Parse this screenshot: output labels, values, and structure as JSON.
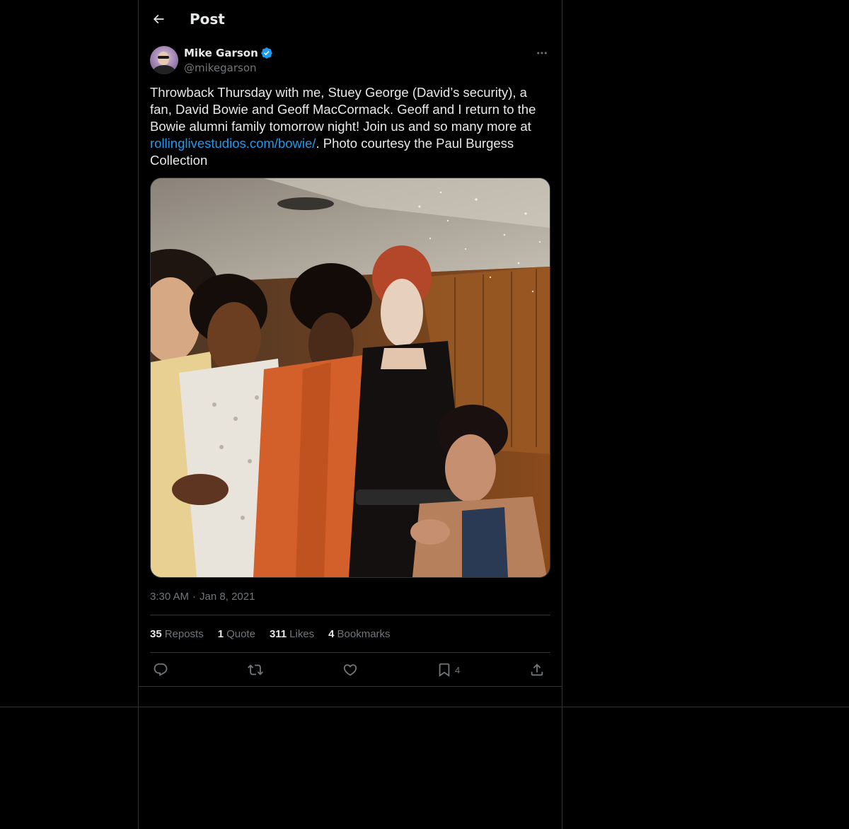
{
  "header": {
    "title": "Post"
  },
  "author": {
    "name": "Mike Garson",
    "handle": "@mikegarson",
    "verified": true
  },
  "tweet": {
    "text_before_link": "Throwback Thursday with me, Stuey George (David’s security), a fan, David Bowie and Geoff MacCormack. Geoff and I return to the Bowie alumni family tomorrow night! Join us and so many more at ",
    "link_text": "rollinglivestudios.com/bowie/",
    "text_after_link": ". Photo courtesy the Paul Burgess Collection",
    "time": "3:30 AM",
    "separator": "·",
    "date": "Jan 8, 2021"
  },
  "stats": {
    "reposts_count": "35",
    "reposts_label": "Reposts",
    "quotes_count": "1",
    "quotes_label": "Quote",
    "likes_count": "311",
    "likes_label": "Likes",
    "bookmarks_count": "4",
    "bookmarks_label": "Bookmarks"
  },
  "actions": {
    "bookmark_count": "4"
  },
  "icons": {
    "back": "arrow-left-icon",
    "verified": "verified-badge-icon",
    "more": "more-horizontal-icon",
    "reply": "reply-icon",
    "repost": "repost-icon",
    "like": "heart-icon",
    "bookmark": "bookmark-icon",
    "share": "share-icon"
  },
  "colors": {
    "background": "#000000",
    "text": "#e7e9ea",
    "muted": "#71767b",
    "link": "#1d9bf0",
    "border": "#2f3336"
  }
}
